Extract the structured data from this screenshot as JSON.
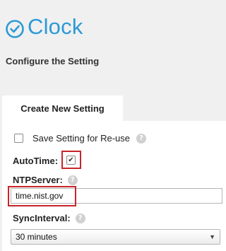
{
  "header": {
    "title": "Clock",
    "subtitle": "Configure the Setting",
    "icon": "clock-icon",
    "accent_color": "#2c9ad6"
  },
  "tab": {
    "label": "Create New Setting"
  },
  "form": {
    "save_setting": {
      "label": "Save Setting for Re-use",
      "checked": false
    },
    "autotime": {
      "label": "AutoTime:",
      "checked": true,
      "check_glyph": "✔"
    },
    "ntpserver": {
      "label": "NTPServer:",
      "value": "time.nist.gov"
    },
    "syncinterval": {
      "label": "SyncInterval:",
      "selected": "30 minutes"
    },
    "help_glyph": "?"
  },
  "highlight_color": "#c8252b"
}
